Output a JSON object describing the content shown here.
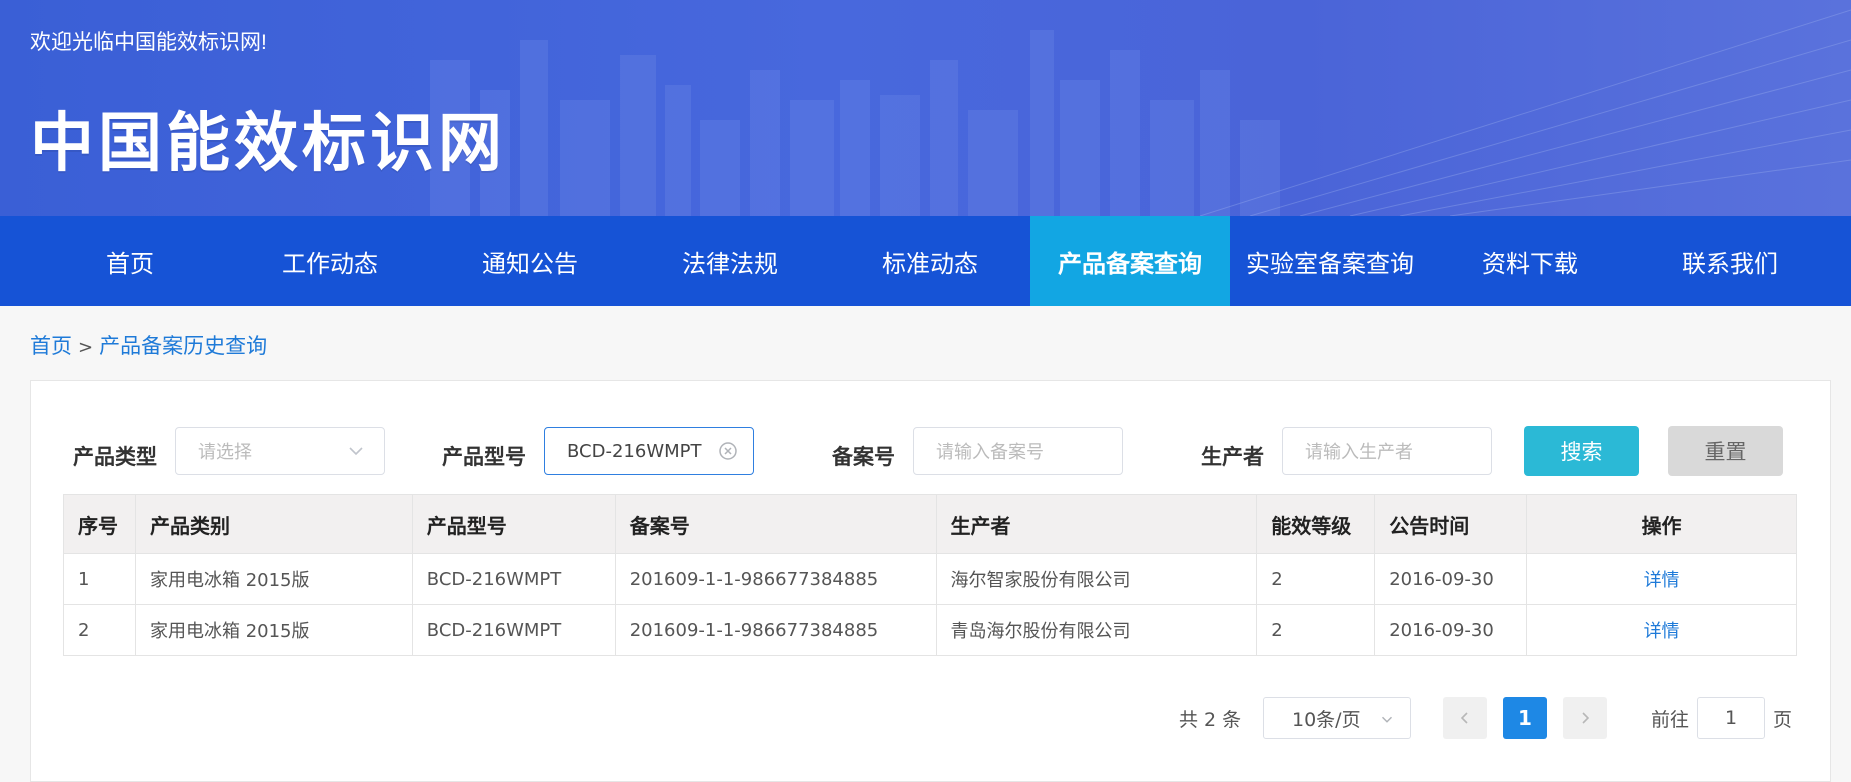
{
  "banner": {
    "welcome": "欢迎光临中国能效标识网!",
    "logo": "中国能效标识网"
  },
  "nav": {
    "items": [
      "首页",
      "工作动态",
      "通知公告",
      "法律法规",
      "标准动态",
      "产品备案查询",
      "实验室备案查询",
      "资料下载",
      "联系我们"
    ],
    "active": "产品备案查询"
  },
  "breadcrumb": {
    "home": "首页",
    "separator": ">",
    "current": "产品备案历史查询"
  },
  "filters": {
    "product_type_label": "产品类型",
    "product_type_placeholder": "请选择",
    "model_label": "产品型号",
    "model_value": "BCD-216WMPT",
    "record_label": "备案号",
    "record_placeholder": "请输入备案号",
    "maker_label": "生产者",
    "maker_placeholder": "请输入生产者",
    "search_button": "搜索",
    "reset_button": "重置"
  },
  "table": {
    "headers": [
      "序号",
      "产品类别",
      "产品型号",
      "备案号",
      "生产者",
      "能效等级",
      "公告时间",
      "操作"
    ],
    "rows": [
      [
        "1",
        "家用电冰箱 2015版",
        "BCD-216WMPT",
        "201609-1-1-986677384885",
        "海尔智家股份有限公司",
        "2",
        "2016-09-30",
        "详情"
      ],
      [
        "2",
        "家用电冰箱 2015版",
        "BCD-216WMPT",
        "201609-1-1-986677384885",
        "青岛海尔股份有限公司",
        "2",
        "2016-09-30",
        "详情"
      ]
    ]
  },
  "pagination": {
    "total_text": "共 2 条",
    "page_size": "10条/页",
    "current_page": "1",
    "goto_prefix": "前往",
    "goto_value": "1",
    "goto_suffix": "页"
  },
  "colors": {
    "nav_bg": "#1653d6",
    "nav_active": "#12a6e3",
    "link": "#1e7ad8",
    "search_btn": "#2bb9d6",
    "page_active": "#1e88e5"
  }
}
